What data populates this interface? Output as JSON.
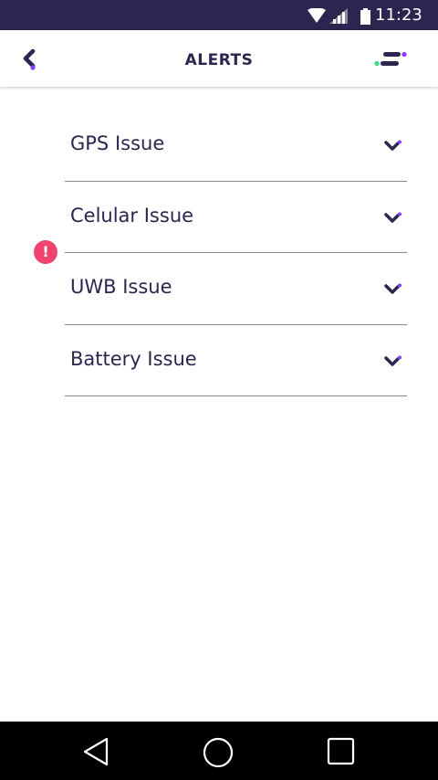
{
  "status_bar": {
    "time": "11:23",
    "icons": [
      "wifi-icon",
      "signal-icon",
      "battery-icon"
    ]
  },
  "app_bar": {
    "title": "ALERTS",
    "back_icon": "chevron-left-icon",
    "menu_icon": "menu-icon"
  },
  "colors": {
    "primary": "#2c2550",
    "accent_purple": "#8b3dff",
    "accent_green": "#3ddc84",
    "alert_red": "#f0446e",
    "divider": "#8a8a8a"
  },
  "alerts": [
    {
      "label": "GPS Issue",
      "has_warning": false
    },
    {
      "label": "Celular Issue",
      "has_warning": false
    },
    {
      "label": "UWB Issue",
      "has_warning": false
    },
    {
      "label": "Battery Issue",
      "has_warning": true
    }
  ],
  "warning_glyph": "!",
  "nav_bar": {
    "buttons": [
      "back-icon",
      "home-icon",
      "recents-icon"
    ]
  }
}
